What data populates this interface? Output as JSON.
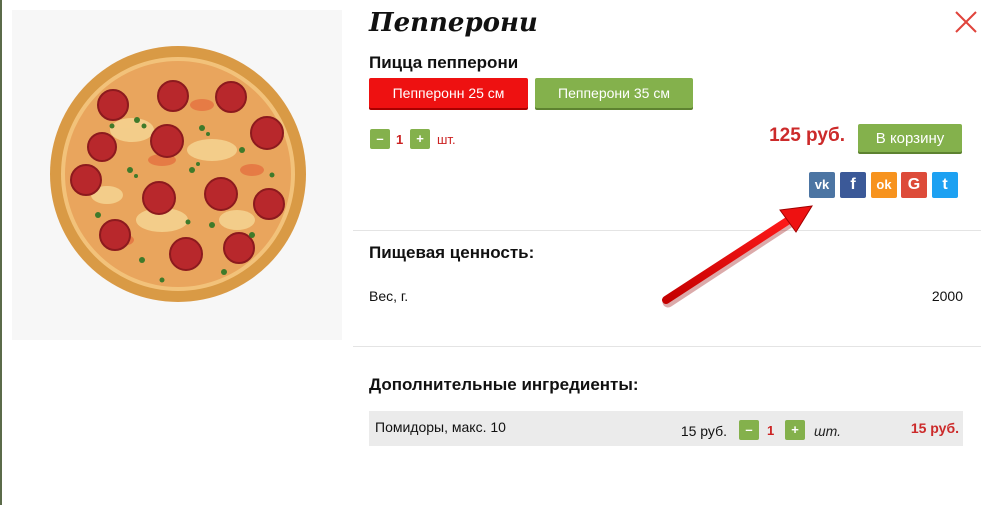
{
  "product": {
    "title": "Пепперони",
    "subtitle": "Пицца пепперони",
    "image_alt": "pizza pepperoni photo"
  },
  "sizes": [
    {
      "label": "Пепперонн 25 см",
      "active": true
    },
    {
      "label": "Пепперони 35 см",
      "active": false
    }
  ],
  "quantity": {
    "minus": "–",
    "value": "1",
    "plus": "+",
    "unit": "шт."
  },
  "price": "125 руб.",
  "cart_button": "В корзину",
  "social": [
    {
      "icon": "vk-icon",
      "glyph": "vk",
      "color": "#4c75a3"
    },
    {
      "icon": "facebook-icon",
      "glyph": "f",
      "color": "#3b5998"
    },
    {
      "icon": "odnoklassniki-icon",
      "glyph": "ok",
      "color": "#f7931e"
    },
    {
      "icon": "google-icon",
      "glyph": "G",
      "color": "#dd4b39"
    },
    {
      "icon": "twitter-icon",
      "glyph": "t",
      "color": "#1da1f2"
    }
  ],
  "nutrition": {
    "heading": "Пищевая ценность:",
    "rows": [
      {
        "label": "Вес, г.",
        "value": "2000"
      }
    ]
  },
  "extras": {
    "heading": "Дополнительные ингредиенты:",
    "items": [
      {
        "name": "Помидоры, макс. 10",
        "price": "15 руб.",
        "minus": "–",
        "qty": "1",
        "plus": "+",
        "unit": "шт.",
        "total": "15 руб."
      }
    ]
  },
  "colors": {
    "accent_red": "#ee1111",
    "accent_green": "#84b14c",
    "price_red": "#cc2a2a",
    "annotation_arrow": "#ee1111"
  }
}
